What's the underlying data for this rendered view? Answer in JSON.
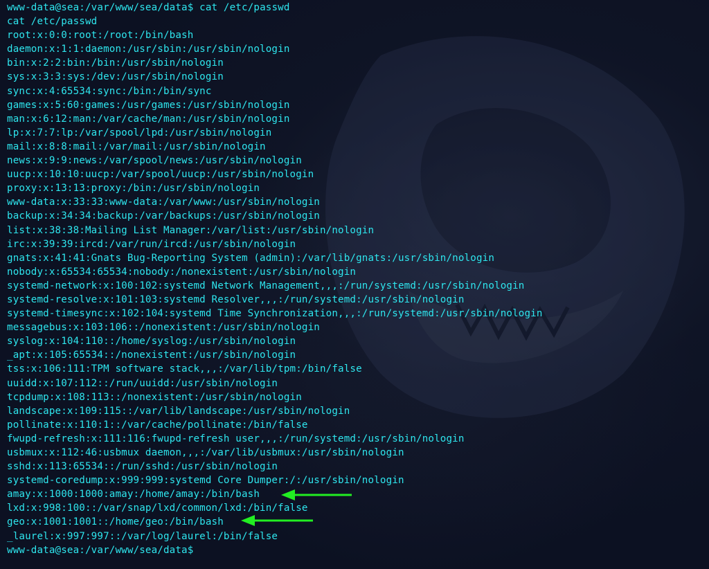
{
  "terminal": {
    "prompt": "www-data@sea:/var/www/sea/data$",
    "command": "cat /etc/passwd",
    "echo": "cat /etc/passwd",
    "output": [
      "root:x:0:0:root:/root:/bin/bash",
      "daemon:x:1:1:daemon:/usr/sbin:/usr/sbin/nologin",
      "bin:x:2:2:bin:/bin:/usr/sbin/nologin",
      "sys:x:3:3:sys:/dev:/usr/sbin/nologin",
      "sync:x:4:65534:sync:/bin:/bin/sync",
      "games:x:5:60:games:/usr/games:/usr/sbin/nologin",
      "man:x:6:12:man:/var/cache/man:/usr/sbin/nologin",
      "lp:x:7:7:lp:/var/spool/lpd:/usr/sbin/nologin",
      "mail:x:8:8:mail:/var/mail:/usr/sbin/nologin",
      "news:x:9:9:news:/var/spool/news:/usr/sbin/nologin",
      "uucp:x:10:10:uucp:/var/spool/uucp:/usr/sbin/nologin",
      "proxy:x:13:13:proxy:/bin:/usr/sbin/nologin",
      "www-data:x:33:33:www-data:/var/www:/usr/sbin/nologin",
      "backup:x:34:34:backup:/var/backups:/usr/sbin/nologin",
      "list:x:38:38:Mailing List Manager:/var/list:/usr/sbin/nologin",
      "irc:x:39:39:ircd:/var/run/ircd:/usr/sbin/nologin",
      "gnats:x:41:41:Gnats Bug-Reporting System (admin):/var/lib/gnats:/usr/sbin/nologin",
      "nobody:x:65534:65534:nobody:/nonexistent:/usr/sbin/nologin",
      "systemd-network:x:100:102:systemd Network Management,,,:/run/systemd:/usr/sbin/nologin",
      "systemd-resolve:x:101:103:systemd Resolver,,,:/run/systemd:/usr/sbin/nologin",
      "systemd-timesync:x:102:104:systemd Time Synchronization,,,:/run/systemd:/usr/sbin/nologin",
      "messagebus:x:103:106::/nonexistent:/usr/sbin/nologin",
      "syslog:x:104:110::/home/syslog:/usr/sbin/nologin",
      "_apt:x:105:65534::/nonexistent:/usr/sbin/nologin",
      "tss:x:106:111:TPM software stack,,,:/var/lib/tpm:/bin/false",
      "uuidd:x:107:112::/run/uuidd:/usr/sbin/nologin",
      "tcpdump:x:108:113::/nonexistent:/usr/sbin/nologin",
      "landscape:x:109:115::/var/lib/landscape:/usr/sbin/nologin",
      "pollinate:x:110:1::/var/cache/pollinate:/bin/false",
      "fwupd-refresh:x:111:116:fwupd-refresh user,,,:/run/systemd:/usr/sbin/nologin",
      "usbmux:x:112:46:usbmux daemon,,,:/var/lib/usbmux:/usr/sbin/nologin",
      "sshd:x:113:65534::/run/sshd:/usr/sbin/nologin",
      "systemd-coredump:x:999:999:systemd Core Dumper:/:/usr/sbin/nologin",
      "amay:x:1000:1000:amay:/home/amay:/bin/bash",
      "lxd:x:998:100::/var/snap/lxd/common/lxd:/bin/false",
      "geo:x:1001:1001::/home/geo:/bin/bash",
      "_laurel:x:997:997::/var/log/laurel:/bin/false"
    ],
    "final_prompt": "www-data@sea:/var/www/sea/data$"
  },
  "colors": {
    "background": "#0c1122",
    "text": "#2ee6ee",
    "arrow": "#22ee22"
  },
  "annotations": [
    {
      "icon": "arrow-left-icon",
      "target_line": "amay:x:1000:1000:amay:/home/amay:/bin/bash"
    },
    {
      "icon": "arrow-left-icon",
      "target_line": "geo:x:1001:1001::/home/geo:/bin/bash"
    }
  ]
}
